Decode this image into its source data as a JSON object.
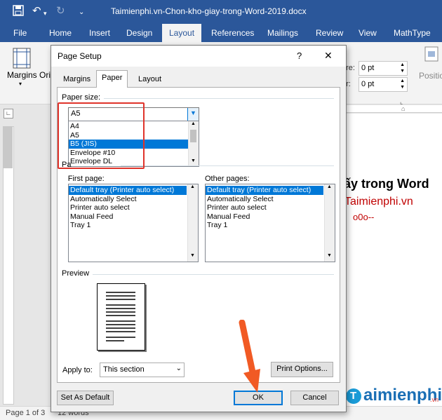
{
  "window": {
    "title": "Taimienphi.vn-Chon-kho-giay-trong-Word-2019.docx",
    "brand_color": "#2b579a"
  },
  "ribbon": {
    "tabs": [
      "File",
      "Home",
      "Insert",
      "Design",
      "Layout",
      "References",
      "Mailings",
      "Review",
      "View",
      "MathType"
    ],
    "active_tab": "Layout",
    "margins_label": "Margins",
    "orientation_partial": "Ori",
    "spacing_before_label": "ore:",
    "spacing_before_value": "0 pt",
    "spacing_after_label": "er:",
    "spacing_after_value": "0 pt",
    "position_label": "Positio"
  },
  "document": {
    "heading_partial": "ấy trong Word",
    "site_text": "Taimienphi.vn",
    "deco_text": "o0o--"
  },
  "status_bar": {
    "page": "Page 1 of 3",
    "words": "12 words"
  },
  "watermark": {
    "text": "aimienphi",
    "suffix": ".vn"
  },
  "dialog": {
    "title": "Page Setup",
    "help": "?",
    "close": "✕",
    "tabs": [
      "Margins",
      "Paper",
      "Layout"
    ],
    "active_tab": "Paper",
    "paper_size_label": "Paper size:",
    "paper_size_value": "A5",
    "paper_size_options": [
      "A4",
      "A5",
      "B5 (JIS)",
      "Envelope #10",
      "Envelope DL"
    ],
    "paper_size_highlighted": "B5 (JIS)",
    "paper_source_label": "Pa",
    "first_page_label": "First page:",
    "other_pages_label": "Other pages:",
    "tray_options": [
      "Default tray (Printer auto select)",
      "Automatically Select",
      "Printer auto select",
      "Manual Feed",
      "Tray 1"
    ],
    "first_page_selected": "Default tray (Printer auto select)",
    "other_pages_selected": "Default tray (Printer auto select)",
    "preview_label": "Preview",
    "apply_to_label": "Apply to:",
    "apply_to_value": "This section",
    "print_options_button": "Print Options...",
    "set_default_button": "Set As Default",
    "ok_button": "OK",
    "cancel_button": "Cancel"
  },
  "colors": {
    "highlight_box": "#e0342b",
    "arrow": "#f15a24",
    "selection": "#0078d7"
  }
}
